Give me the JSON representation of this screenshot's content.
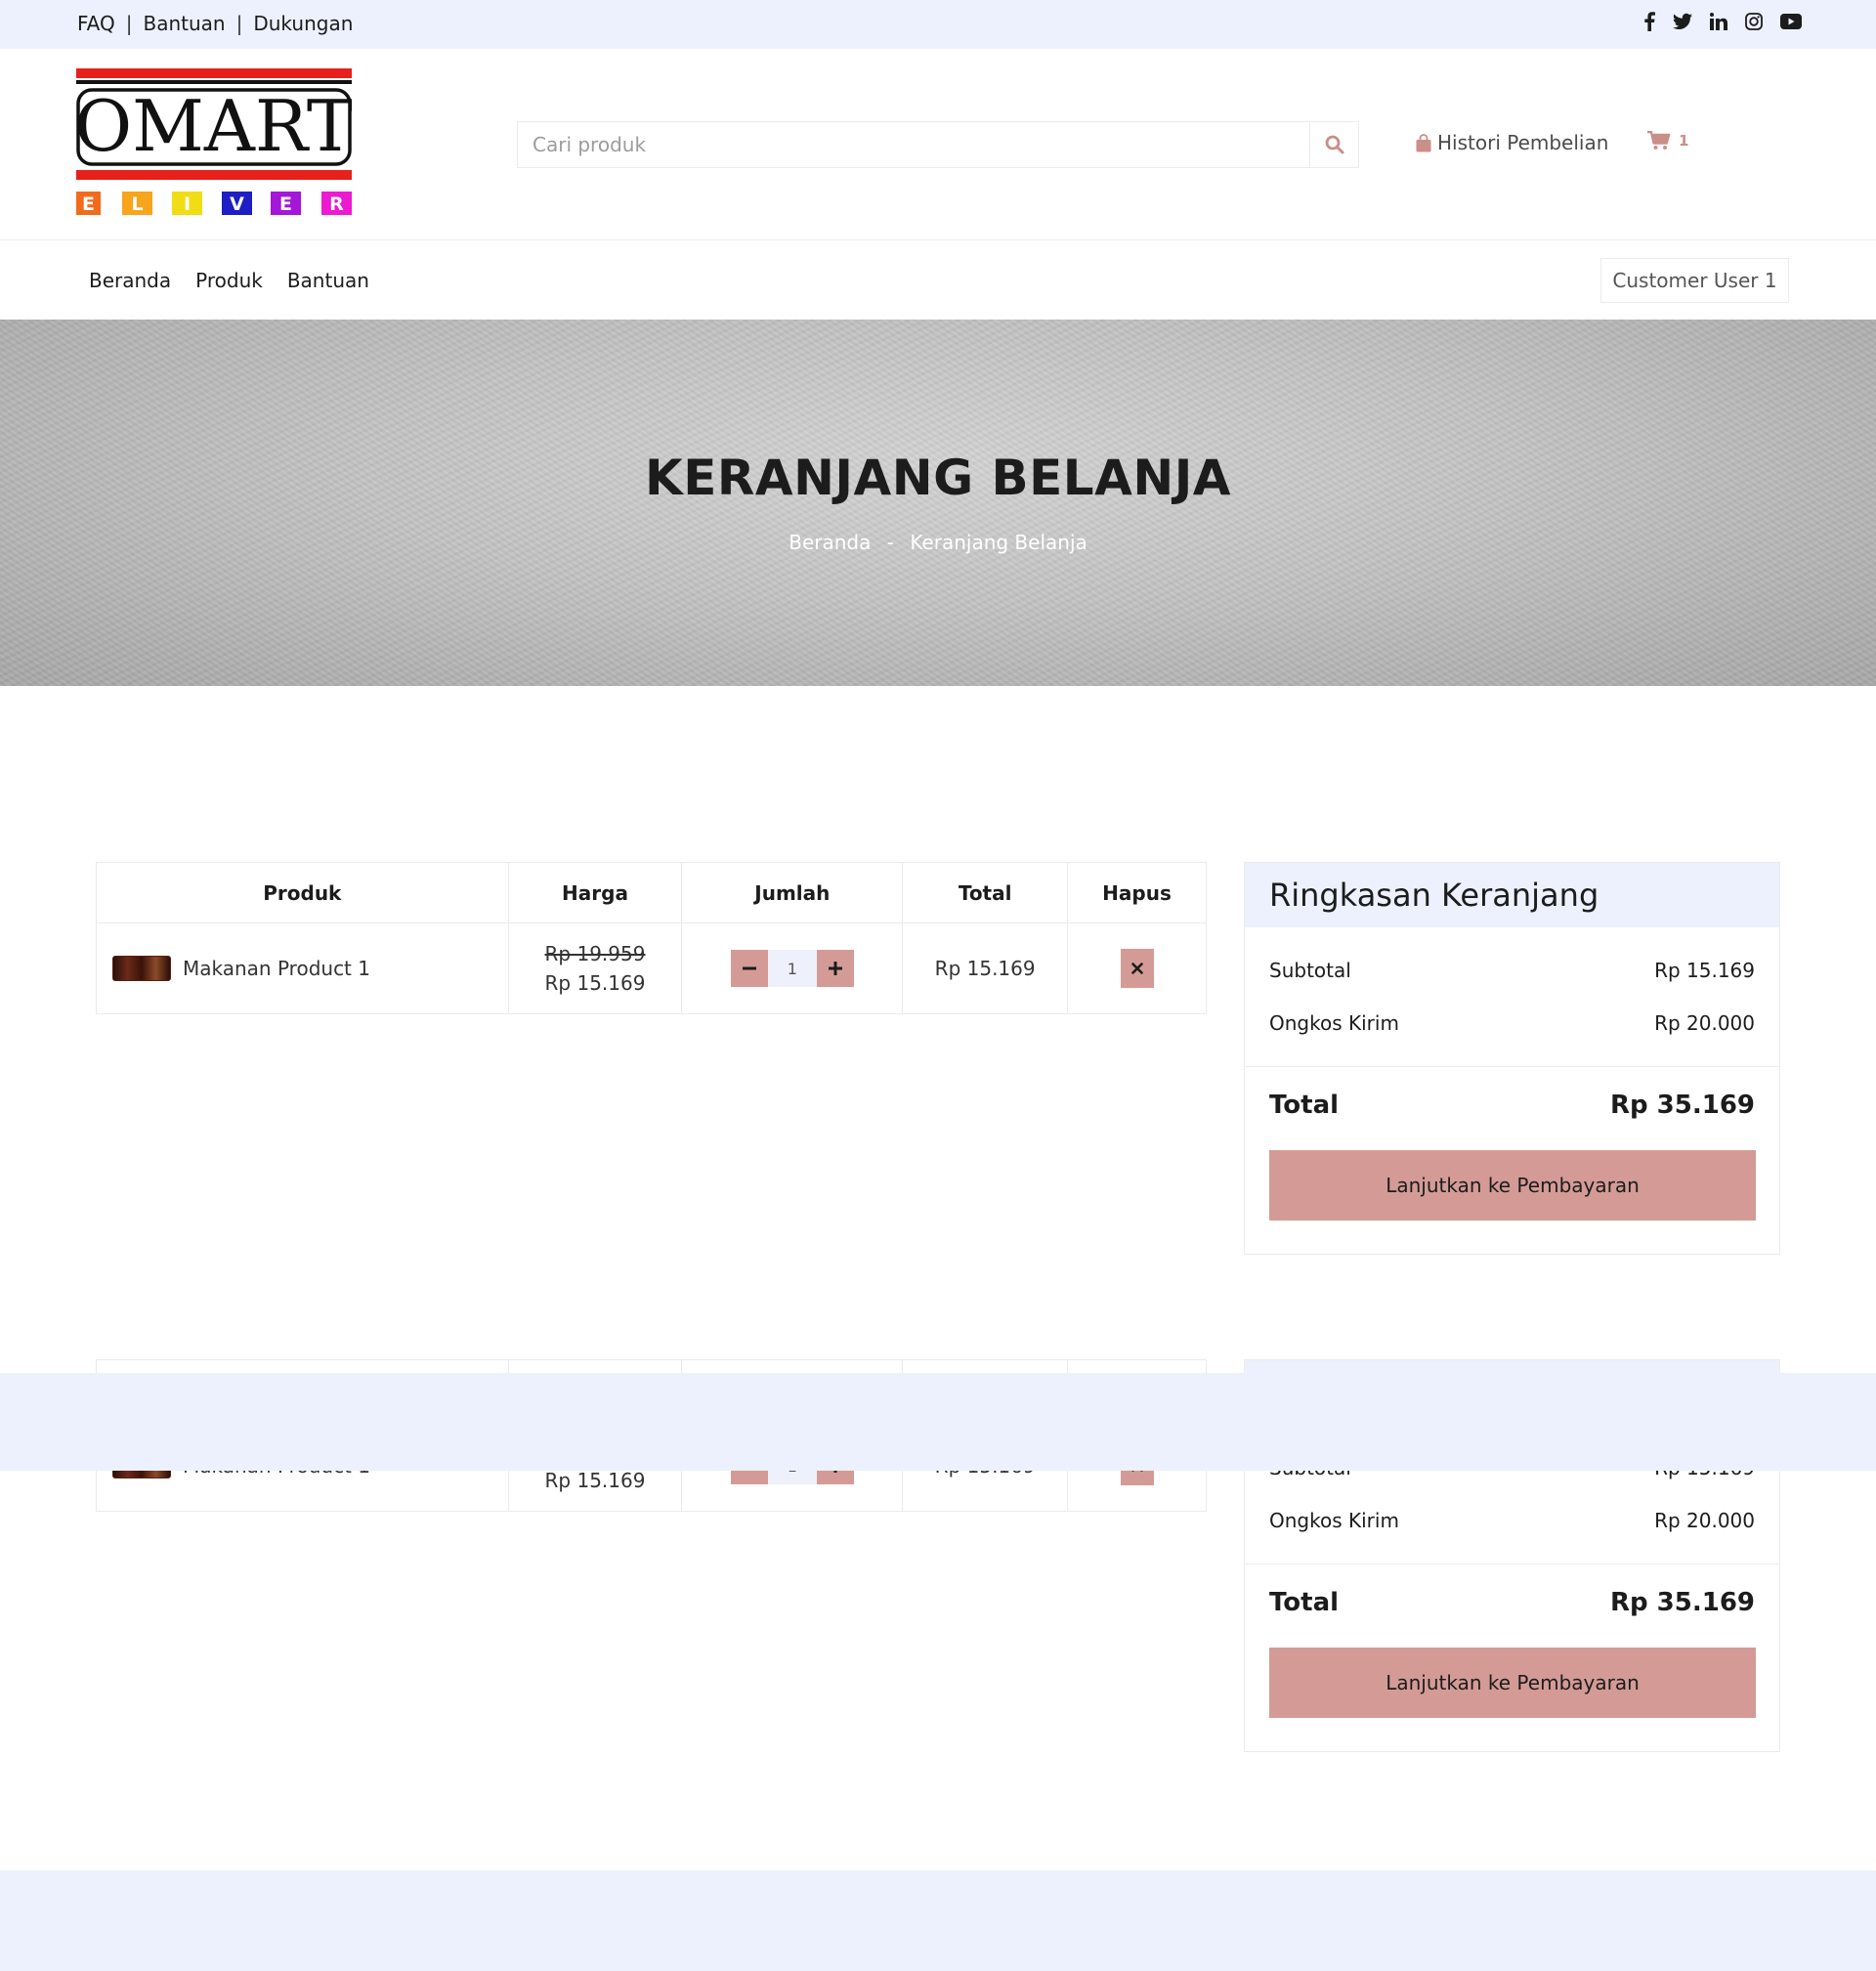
{
  "topbar": {
    "links": [
      "FAQ",
      "Bantuan",
      "Dukungan"
    ],
    "separator": "|",
    "social_icons": [
      "facebook-icon",
      "twitter-icon",
      "linkedin-icon",
      "instagram-icon",
      "youtube-icon"
    ]
  },
  "header": {
    "logo_text": "OMART",
    "logo_letters": [
      "E",
      "L",
      "I",
      "V",
      "E",
      "R"
    ],
    "search_placeholder": "Cari produk",
    "search_value": "",
    "history_label": "Histori Pembelian",
    "cart_count": "1"
  },
  "nav": {
    "items": [
      "Beranda",
      "Produk",
      "Bantuan"
    ],
    "user_label": "Customer User 1"
  },
  "hero": {
    "title": "KERANJANG BELANJA",
    "breadcrumb": [
      "Beranda",
      "Keranjang Belanja"
    ],
    "breadcrumb_sep": "-"
  },
  "cart": {
    "columns": [
      "Produk",
      "Harga",
      "Jumlah",
      "Total",
      "Hapus"
    ],
    "rows": [
      {
        "product": "Makanan Product 1",
        "price_old": "Rp 19.959",
        "price_new": "Rp 15.169",
        "quantity": "1",
        "total": "Rp 15.169"
      }
    ],
    "qty_minus": "−",
    "qty_plus": "+"
  },
  "summary": {
    "title": "Ringkasan Keranjang",
    "subtotal_label": "Subtotal",
    "subtotal_value": "Rp 15.169",
    "shipping_label": "Ongkos Kirim",
    "shipping_value": "Rp 20.000",
    "total_label": "Total",
    "total_value": "Rp 35.169",
    "checkout_label": "Lanjutkan ke Pembayaran"
  },
  "colors": {
    "accent": "#d49b96",
    "band": "#edf1fe",
    "logo_red": "#e8201b"
  }
}
